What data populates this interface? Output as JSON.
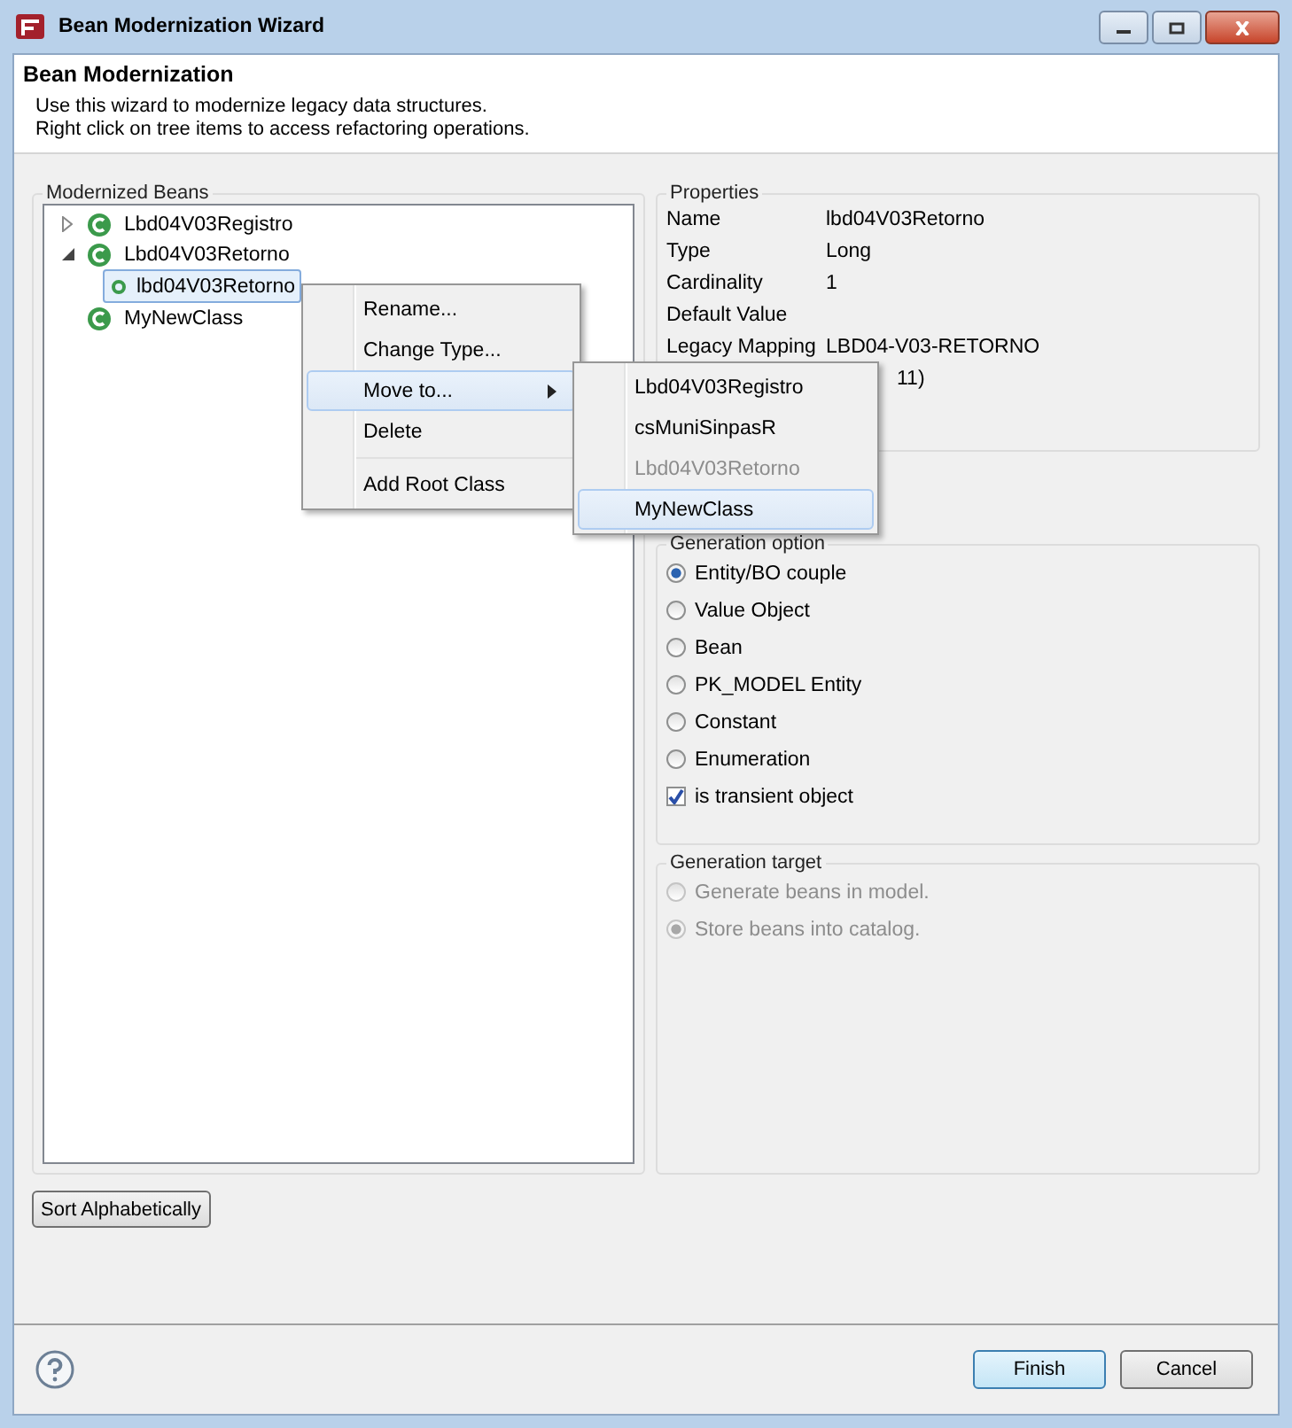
{
  "window": {
    "title": "Bean Modernization Wizard"
  },
  "header": {
    "title": "Bean Modernization",
    "description": [
      "Use this wizard to modernize legacy data structures.",
      "Right click on tree items to access refactoring operations."
    ]
  },
  "tree": {
    "title": "Modernized Beans",
    "items": [
      {
        "label": "Lbd04V03Registro",
        "kind": "class",
        "expanded": false,
        "selected": false
      },
      {
        "label": "Lbd04V03Retorno",
        "kind": "class",
        "expanded": true,
        "selected": false,
        "children": [
          {
            "label": "lbd04V03Retorno",
            "kind": "field",
            "selected": true
          }
        ]
      },
      {
        "label": "MyNewClass",
        "kind": "class",
        "selected": false
      }
    ]
  },
  "context_menu": {
    "groups": [
      {
        "items": [
          {
            "label": "Rename...",
            "selected": false,
            "submenu": false
          },
          {
            "label": "Change Type...",
            "selected": false,
            "submenu": false
          },
          {
            "label": "Move to...",
            "selected": true,
            "submenu": true
          },
          {
            "label": "Delete",
            "selected": false,
            "submenu": false
          }
        ]
      },
      {
        "items": [
          {
            "label": "Add Root Class",
            "selected": false,
            "submenu": false
          }
        ]
      }
    ]
  },
  "submenu": {
    "items": [
      {
        "label": "Lbd04V03Registro",
        "disabled": false,
        "selected": false
      },
      {
        "label": "csMuniSinpasR",
        "disabled": false,
        "selected": false
      },
      {
        "label": "Lbd04V03Retorno",
        "disabled": true,
        "selected": false
      },
      {
        "label": "MyNewClass",
        "disabled": false,
        "selected": true
      }
    ]
  },
  "properties": {
    "title": "Properties",
    "rows": [
      {
        "label": "Name",
        "value": "lbd04V03Retorno"
      },
      {
        "label": "Type",
        "value": "Long"
      },
      {
        "label": "Cardinality",
        "value": "1"
      },
      {
        "label": "Default Value"
      },
      {
        "label": "Legacy Mapping",
        "value": "LBD04-V03-RETORNO"
      },
      {
        "value": "11)"
      }
    ]
  },
  "generation_option": {
    "title": "Generation option",
    "options": [
      {
        "label": "Entity/BO couple",
        "kind": "radio",
        "checked": true
      },
      {
        "label": "Value Object",
        "kind": "radio",
        "checked": false
      },
      {
        "label": "Bean",
        "kind": "radio",
        "checked": false
      },
      {
        "label": "PK_MODEL Entity",
        "kind": "radio",
        "checked": false
      },
      {
        "label": "Constant",
        "kind": "radio",
        "checked": false
      },
      {
        "label": "Enumeration",
        "kind": "radio",
        "checked": false
      },
      {
        "label": "is transient object",
        "kind": "checkbox",
        "checked": true
      }
    ]
  },
  "generation_target": {
    "title": "Generation target",
    "options": [
      {
        "label": "Generate beans in model.",
        "checked": false,
        "disabled": true
      },
      {
        "label": "Store beans into catalog.",
        "checked": true,
        "disabled": true
      }
    ]
  },
  "sort_button": "Sort Alphabetically",
  "buttons": [
    {
      "label": "Finish",
      "default": true
    },
    {
      "label": "Cancel",
      "default": false
    }
  ]
}
